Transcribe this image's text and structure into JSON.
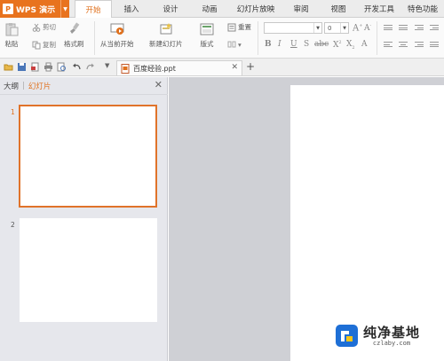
{
  "app": {
    "name": "WPS 演示",
    "logo_letter": "P"
  },
  "menu_tabs": [
    "开始",
    "插入",
    "设计",
    "动画",
    "幻灯片放映",
    "审阅",
    "视图",
    "开发工具",
    "特色功能"
  ],
  "active_menu_tab": "开始",
  "ribbon": {
    "paste": "粘贴",
    "cut": "剪切",
    "copy": "复制",
    "format_painter": "格式刷",
    "from_current": "从当前开始",
    "new_slide": "新建幻灯片",
    "layout": "版式",
    "reset": "重置",
    "font_size_value": "0"
  },
  "document_tab": {
    "filename": "百度经验.ppt"
  },
  "left_pane": {
    "tab_outline": "大纲",
    "tab_slides": "幻灯片",
    "separator": "|",
    "slide_numbers": [
      "1",
      "2"
    ]
  },
  "watermark": {
    "title": "纯净基地",
    "subtitle": "czlaby.com"
  },
  "colors": {
    "accent": "#e0701c",
    "app_button": "#e8731e",
    "pane_bg": "#e6e7ec",
    "editor_bg": "#cfd0d5"
  }
}
